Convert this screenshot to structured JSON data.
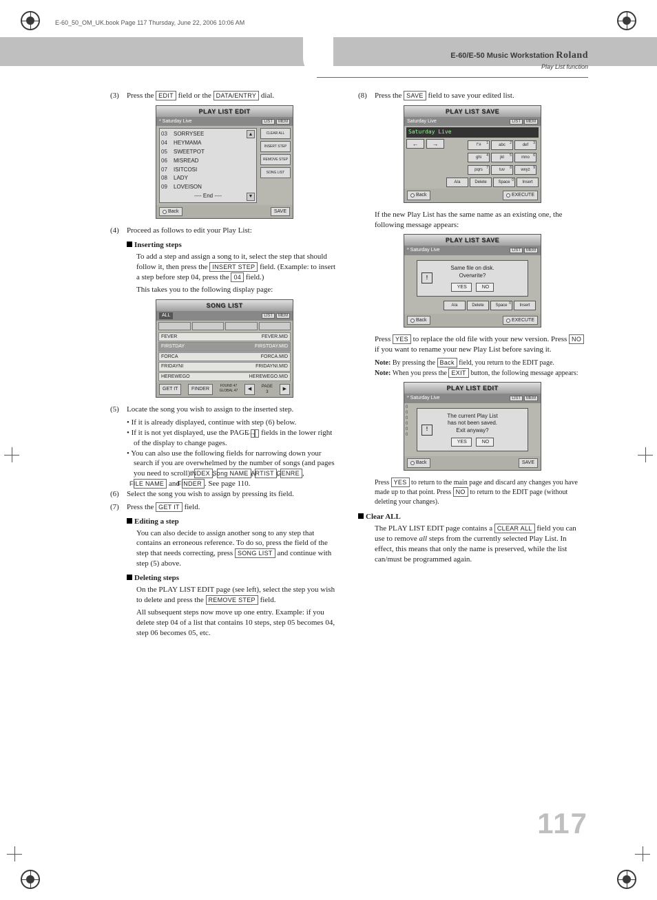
{
  "page_info": "E-60_50_OM_UK.book  Page 117  Thursday, June 22, 2006  10:06 AM",
  "header": {
    "product": "E-60/E-50 Music Workstation",
    "brand": "Roland",
    "section": "Play List function"
  },
  "page_number": "117",
  "buttons": {
    "edit": "EDIT",
    "data_entry": "DATA/ENTRY",
    "insert_step": "INSERT STEP",
    "field_04": "04",
    "index": "INDEX",
    "song_name": "Song NAME",
    "artist": "ARTIST",
    "genre": "GENRE",
    "file_name": "FILE NAME",
    "finder": "FINDER",
    "get_it": "GET IT",
    "song_list": "SONG LIST",
    "remove_step": "REMOVE STEP",
    "save": "SAVE",
    "yes": "YES",
    "no": "NO",
    "back": "Back",
    "exit": "EXIT",
    "clear_all": "CLEAR ALL",
    "left_arrow": "←",
    "right_arrow": "→"
  },
  "left": {
    "s3": "Press the ",
    "s3b": " field or the ",
    "s3c": " dial.",
    "s4": "Proceed as follows to edit your Play List:",
    "h_insert": "Inserting steps",
    "p_insert1": "To add a step and assign a song to it, select the step that should follow it, then press the ",
    "p_insert2": "field. (Example: to insert a step before step 04, press the ",
    "p_insert3": " field.)",
    "p_insert4": "This takes you to the following display page:",
    "s5": "Locate the song you wish to assign to the inserted step.",
    "b1": "If it is already displayed, continue with step (6) below.",
    "b2a": "If it is not yet displayed, use the PAGE ",
    "b2b": " fields in the lower right of the display to change pages.",
    "b3": "You can also use the following fields for narrowing down your search if you are overwhelmed by the number of songs (and pages you need to scroll): ",
    "b3end": ". See page 110.",
    "s6": "Select the song you wish to assign by pressing its field.",
    "s7": "Press the ",
    "s7b": " field.",
    "h_editing": "Editing a step",
    "p_edit": "You can also decide to assign another song to any step that contains an erroneous reference. To do so, press the field of the step that needs correcting, press ",
    "p_edit2": " and continue with step (5) above.",
    "h_deleting": "Deleting steps",
    "p_del1": "On the PLAY LIST EDIT page (see left), select the step you wish to delete and press the ",
    "p_del2": " field.",
    "p_del3": "All subsequent steps now move up one entry. Example: if you delete step 04 of a list that contains 10 steps, step 05 becomes 04, step 06 becomes 05, etc."
  },
  "right": {
    "s8": "Press the ",
    "s8b": " field to save your edited list.",
    "p_same": "If the new Play List has the same name as an existing one, the following message appears:",
    "p_yes": "Press ",
    "p_yes2": " to replace the old file with your new version. Press ",
    "p_yes3": " if you want to rename your new Play List before saving it.",
    "note1a": "By pressing the ",
    "note1b": " field, you return to the EDIT page.",
    "note2a": "When you press the ",
    "note2b": " button, the following message appears:",
    "p_exit": "Press ",
    "p_exit2": " to return to the main page and discard any changes you have made up to that point. Press ",
    "p_exit3": " to return to the EDIT page (without deleting your changes).",
    "h_clear": "Clear ALL",
    "p_clear1": "The PLAY LIST EDIT page contains a ",
    "p_clear2": " field you can use to remove ",
    "p_clear_all_italic": "all",
    "p_clear3": " steps from the currently selected Play List. In effect, this means that only the name is preserved, while the list can/must be programmed again."
  },
  "shot_edit": {
    "title": "PLAY LIST EDIT",
    "listname": "* Saturday Live",
    "items": [
      [
        "03",
        "SORRYSEE"
      ],
      [
        "04",
        "HEYMAMA"
      ],
      [
        "05",
        "SWEETPOT"
      ],
      [
        "06",
        "MISREAD"
      ],
      [
        "07",
        "ISITCOSI"
      ],
      [
        "08",
        "LADY"
      ],
      [
        "09",
        "LOVEISON"
      ]
    ],
    "end": "---- End ----",
    "side": [
      "CLEAR ALL",
      "INSERT STEP",
      "REMOVE STEP",
      "SONG LIST"
    ],
    "back": "Back",
    "save": "SAVE"
  },
  "shot_songlist": {
    "title": "SONG LIST",
    "all": "ALL",
    "rows": [
      [
        "FEVER",
        "FEVER.MID"
      ],
      [
        "FIRSTDAY",
        "FIRSTDAY.MID"
      ],
      [
        "FORCA",
        "FORCA.MID"
      ],
      [
        "FRIDAYNI",
        "FRIDAYNI.MID"
      ],
      [
        "HEREWEGO",
        "HEREWEGO.MID"
      ]
    ],
    "finder": "FINDER",
    "page": "PAGE",
    "found": "FOUND",
    "global": "GLOBAL"
  },
  "shot_save": {
    "title": "PLAY LIST SAVE",
    "listname": "Saturday Live",
    "name": "Saturday Live",
    "keys_row1": [
      [
        "!\"#",
        "1"
      ],
      [
        "abc",
        "2"
      ],
      [
        "def",
        "3"
      ]
    ],
    "keys_row2": [
      [
        "ghi",
        "4"
      ],
      [
        "jkl",
        "5"
      ],
      [
        "mno",
        "6"
      ]
    ],
    "keys_row3": [
      [
        "pqrs",
        "7"
      ],
      [
        "tuv",
        "8"
      ],
      [
        "wxyz",
        "9"
      ]
    ],
    "keys_row4": [
      [
        "A/a",
        ""
      ],
      [
        "Delete",
        ""
      ],
      [
        "Space",
        "0"
      ],
      [
        "Insert",
        ""
      ]
    ],
    "back": "Back",
    "exec": "EXECUTE"
  },
  "shot_overwrite": {
    "title": "PLAY LIST SAVE",
    "listname": "* Saturday Live",
    "msg1": "Same file on disk.",
    "msg2": "Overwrite?",
    "yes": "YES",
    "no": "NO",
    "keys_row4": [
      [
        "A/a",
        ""
      ],
      [
        "Delete",
        ""
      ],
      [
        "Space",
        "0"
      ],
      [
        "Insert",
        ""
      ]
    ],
    "back": "Back",
    "exec": "EXECUTE"
  },
  "shot_exit": {
    "title": "PLAY LIST EDIT",
    "listname": "* Saturday Live",
    "msg1": "The current Play List",
    "msg2": "has not been saved.",
    "msg3": "Exit anyway?",
    "yes": "YES",
    "no": "NO",
    "back": "Back",
    "save": "SAVE"
  }
}
